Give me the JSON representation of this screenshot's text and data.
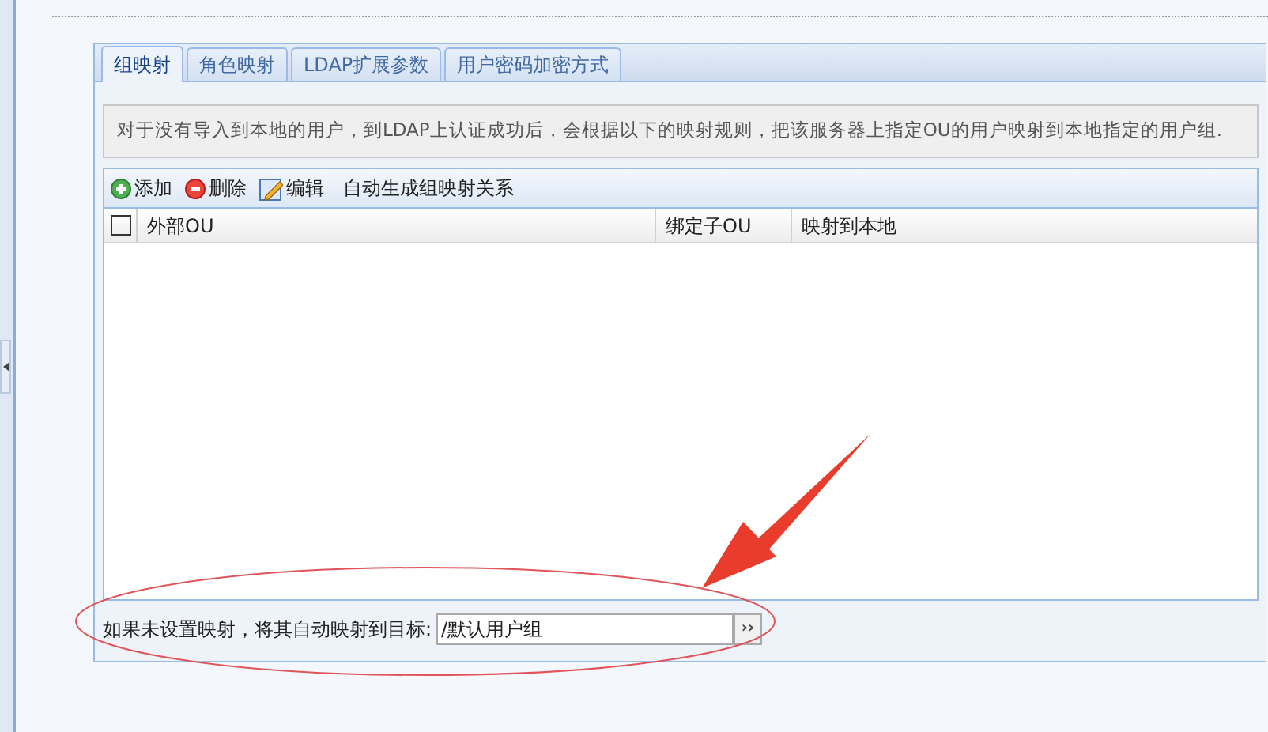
{
  "tabs": [
    {
      "label": "组映射",
      "selected": true
    },
    {
      "label": "角色映射",
      "selected": false
    },
    {
      "label": "LDAP扩展参数",
      "selected": false
    },
    {
      "label": "用户密码加密方式",
      "selected": false
    }
  ],
  "info": "对于没有导入到本地的用户，到LDAP上认证成功后，会根据以下的映射规则，把该服务器上指定OU的用户映射到本地指定的用户组.",
  "toolbar": [
    {
      "kind": "add",
      "label": "添加"
    },
    {
      "kind": "delete",
      "label": "删除"
    },
    {
      "kind": "edit",
      "label": "编辑"
    },
    {
      "kind": "text",
      "label": "自动生成组映射关系"
    }
  ],
  "table": {
    "select_all": {
      "checked": false
    },
    "columns": [
      "外部OU",
      "绑定子OU",
      "映射到本地"
    ]
  },
  "default_target": {
    "label": "如果未设置映射，将其自动映射到目标:",
    "value": "/默认用户组",
    "button": "››"
  }
}
